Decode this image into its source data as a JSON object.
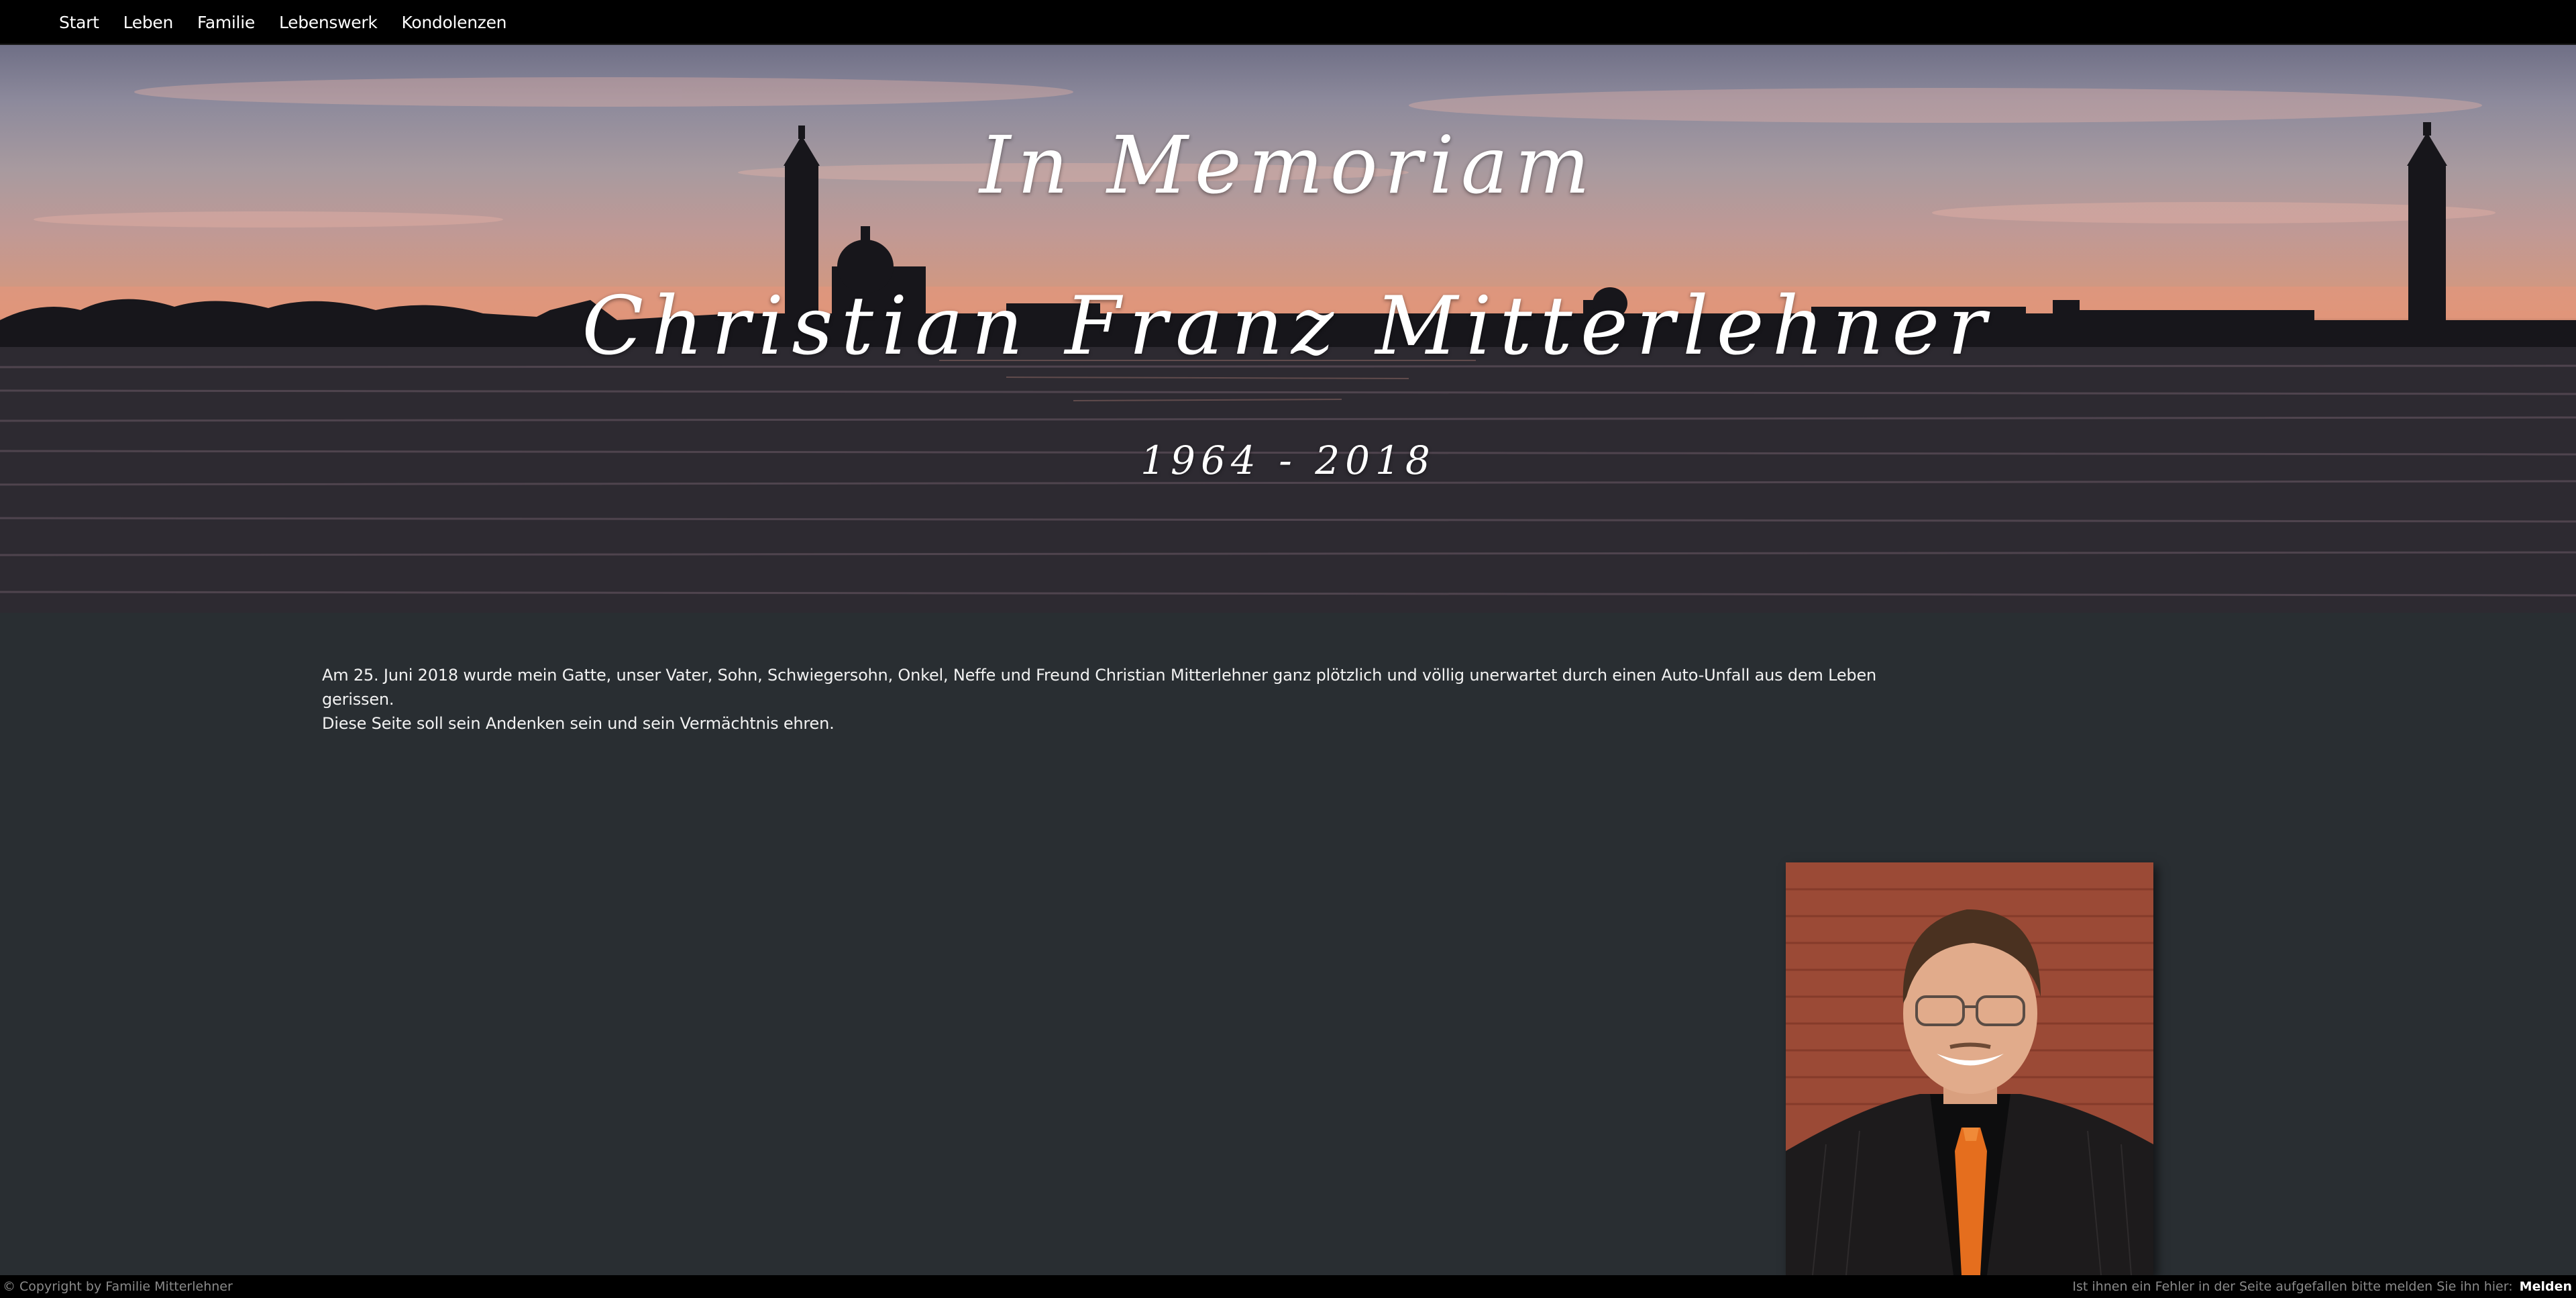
{
  "nav": {
    "items": [
      {
        "label": "Start"
      },
      {
        "label": "Leben"
      },
      {
        "label": "Familie"
      },
      {
        "label": "Lebenswerk"
      },
      {
        "label": "Kondolenzen"
      }
    ]
  },
  "hero": {
    "line1": "In Memoriam",
    "line2": "Christian Franz Mitterlehner",
    "years": "1964 - 2018"
  },
  "intro": {
    "paragraph1": "Am 25. Juni 2018 wurde mein Gatte, unser Vater, Sohn, Schwiegersohn, Onkel, Neffe und Freund Christian Mitterlehner ganz plötzlich und völlig unerwartet durch einen Auto-Unfall aus dem Leben gerissen.",
    "paragraph2": "Diese Seite soll sein Andenken sein und sein Vermächtnis ehren."
  },
  "footer": {
    "copyright": "© Copyright by Familie Mitterlehner",
    "report_text": "Ist ihnen ein Fehler in der Seite aufgefallen bitte melden Sie ihn hier:",
    "report_link": "Melden"
  },
  "colors": {
    "page_background": "#292e32",
    "nav_background": "#000000",
    "footer_background": "#000000"
  }
}
